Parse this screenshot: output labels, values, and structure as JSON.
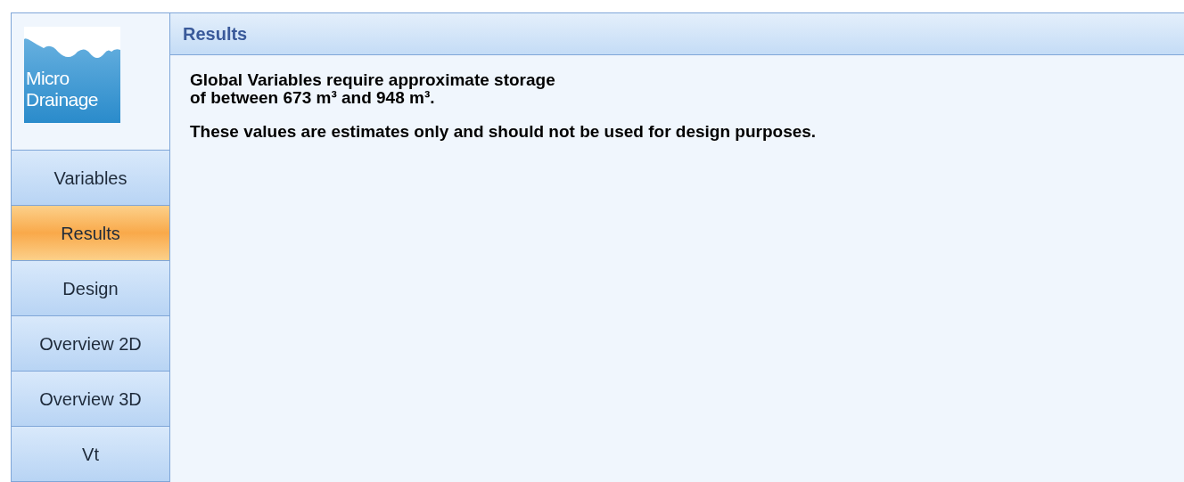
{
  "logo": {
    "lines": [
      "Micro",
      "Drainage"
    ]
  },
  "nav": [
    {
      "label": "Variables",
      "selected": false
    },
    {
      "label": "Results",
      "selected": true
    },
    {
      "label": "Design",
      "selected": false
    },
    {
      "label": "Overview 2D",
      "selected": false
    },
    {
      "label": "Overview 3D",
      "selected": false
    },
    {
      "label": "Vt",
      "selected": false
    }
  ],
  "panel": {
    "title": "Results",
    "message_lines": [
      "Global Variables require approximate storage",
      "of between 673 m³ and 948 m³."
    ],
    "note": "These values are estimates only and should not be used for design purposes."
  }
}
